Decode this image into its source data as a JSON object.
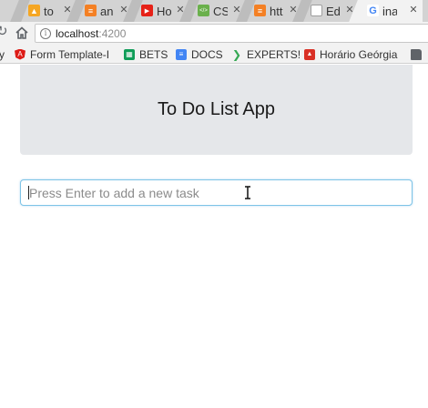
{
  "browser": {
    "tabs": [
      {
        "label": "to",
        "favicon": "firebase-icon",
        "color": "#f5a623",
        "glyph": "▲"
      },
      {
        "label": "an",
        "favicon": "stackoverflow-icon",
        "color": "#f48024",
        "glyph": "≡"
      },
      {
        "label": "Ho",
        "favicon": "youtube-icon",
        "color": "#e62117",
        "glyph": "▶"
      },
      {
        "label": "CS",
        "favicon": "code-icon",
        "color": "#6ab04c",
        "glyph": "</>"
      },
      {
        "label": "htt",
        "favicon": "stackoverflow-icon",
        "color": "#f48024",
        "glyph": "≡"
      },
      {
        "label": "Ed",
        "favicon": "document-icon",
        "color": "#9e9e9e",
        "glyph": ""
      },
      {
        "label": "ina",
        "favicon": "google-icon",
        "color": "#4285f4",
        "glyph": "G"
      }
    ],
    "address": {
      "host": "localhost",
      "port": ":4200"
    },
    "bookmarks": [
      {
        "label": "y",
        "icon": ""
      },
      {
        "label": "Form Template-I",
        "icon": "angular-icon",
        "color": "#dd1b16",
        "glyph": "A"
      },
      {
        "label": "BETS",
        "icon": "sheets-icon",
        "color": "#0f9d58",
        "glyph": "▦"
      },
      {
        "label": "DOCS",
        "icon": "docs-icon",
        "color": "#4285f4",
        "glyph": "≡"
      },
      {
        "label": "EXPERTS!",
        "icon": "arrow-icon",
        "color": "#34a853",
        "glyph": "❯"
      },
      {
        "label": "Horário Geórgia",
        "icon": "image-icon",
        "color": "#d93025",
        "glyph": "▲"
      },
      {
        "label": "",
        "icon": "folder-icon",
        "color": "#5f6368",
        "glyph": ""
      }
    ]
  },
  "app": {
    "title": "To Do List App",
    "input_placeholder": "Press Enter to add a new task",
    "input_value": ""
  }
}
